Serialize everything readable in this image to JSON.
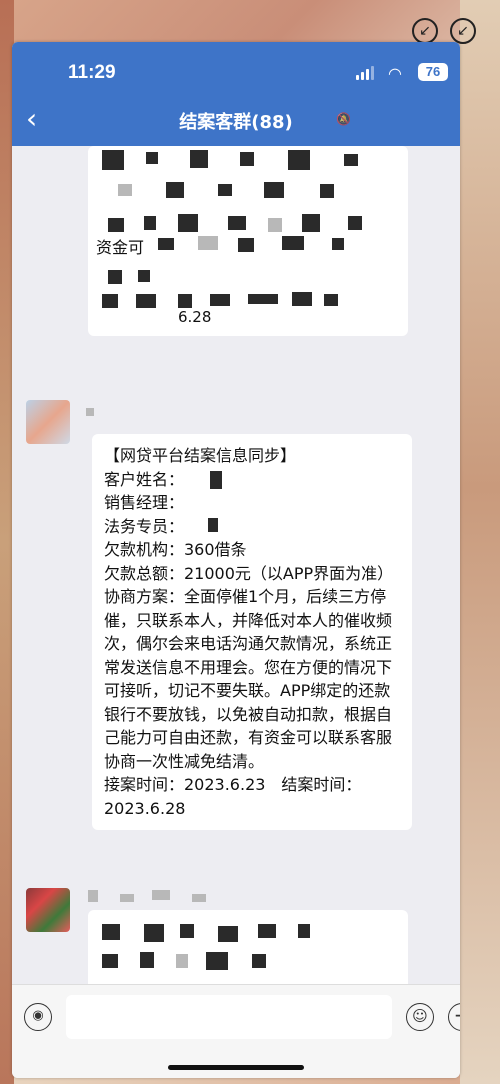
{
  "status_bar": {
    "time": "11:29",
    "battery": "76",
    "wifi_icon": "wifi-icon",
    "signal_icon": "signal-icon"
  },
  "nav": {
    "back_icon": "chevron-left-icon",
    "title": "结案客群(88)",
    "mute_icon": "mute-icon"
  },
  "messages": {
    "top_fragment": "资金可",
    "top_fragment_time": "6.28",
    "case_message": {
      "lines": [
        "【网贷平台结案信息同步】",
        "客户姓名：",
        "销售经理：",
        "法务专员：",
        "欠款机构：360借条",
        "欠款总额：21000元（以APP界面为准）",
        "协商方案：全面停催1个月，后续三方停催，只联系本人，并降低对本人的催收频次，偶尔会来电话沟通欠款情况，系统正常发送信息不用理会。您在方便的情况下可接听，切记不要失联。APP绑定的还款银行不要放钱，以免被自动扣款，根据自己能力可自由还款，有资金可以联系客服协商一次性减免结清。",
        "接案时间：2023.6.23　结案时间：2023.6.28"
      ]
    }
  },
  "input_bar": {
    "voice_icon": "voice-icon",
    "emoji_icon": "emoji-icon",
    "plus_icon": "plus-icon"
  },
  "colors": {
    "header": "#3e74c8",
    "chat_bg": "#ededf2",
    "bubble": "#ffffff"
  }
}
